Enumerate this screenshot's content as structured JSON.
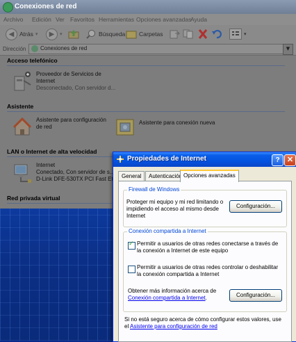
{
  "window": {
    "title": "Conexiones de red"
  },
  "menubar": {
    "items": [
      "Archivo",
      "Edición",
      "Ver",
      "Favoritos",
      "Herramientas",
      "Opciones avanzadas",
      "Ayuda"
    ]
  },
  "toolbar": {
    "back_label": "Atrás",
    "search_label": "Búsqueda",
    "folders_label": "Carpetas"
  },
  "address": {
    "label": "Dirección",
    "value": "Conexiones de red"
  },
  "groups": {
    "dialup": {
      "heading": "Acceso telefónico",
      "item_title": "Proveedor de Servicios de Internet",
      "item_status": "Desconectado, Con servidor d..."
    },
    "wizard": {
      "heading": "Asistente",
      "item1": "Asistente para configuración de red",
      "item2": "Asistente para conexión nueva"
    },
    "lan": {
      "heading": "LAN o Internet de alta velocidad",
      "item_title": "Internet",
      "item_status": "Conectado, Con servidor de s...",
      "item_device": "D-Link DFE-530TX PCI Fast Et..."
    },
    "vpn": {
      "heading": "Red privada virtual"
    }
  },
  "dialog": {
    "title": "Propiedades de Internet",
    "help_label": "?",
    "close_label": "✕",
    "tabs": [
      "General",
      "Autenticación",
      "Opciones avanzadas"
    ],
    "firewall": {
      "legend": "Firewall de Windows",
      "text": "Proteger mi equipo y mi red limitando o impidiendo el acceso al mismo desde Internet",
      "button": "Configuración..."
    },
    "ics": {
      "legend": "Conexión compartida a Internet",
      "check1_label": "Permitir a usuarios de otras redes conectarse a través de la conexión a Internet de este equipo",
      "check1_checked": true,
      "check2_label": "Permitir a usuarios de otras redes controlar o deshabilitar la conexión compartida a Internet",
      "check2_checked": false,
      "more_info_prefix": "Obtener más información acerca de",
      "more_info_link": "Conexión compartida a Internet",
      "more_info_suffix": ".",
      "button": "Configuración..."
    },
    "footer": {
      "prefix": "Si no está seguro acerca de cómo configurar estos valores, use el",
      "link": "Asistente para configuración de red"
    }
  },
  "colors": {
    "dialog_title": "#0453e0",
    "group_legend": "#0046d5",
    "link": "#0000ee"
  }
}
